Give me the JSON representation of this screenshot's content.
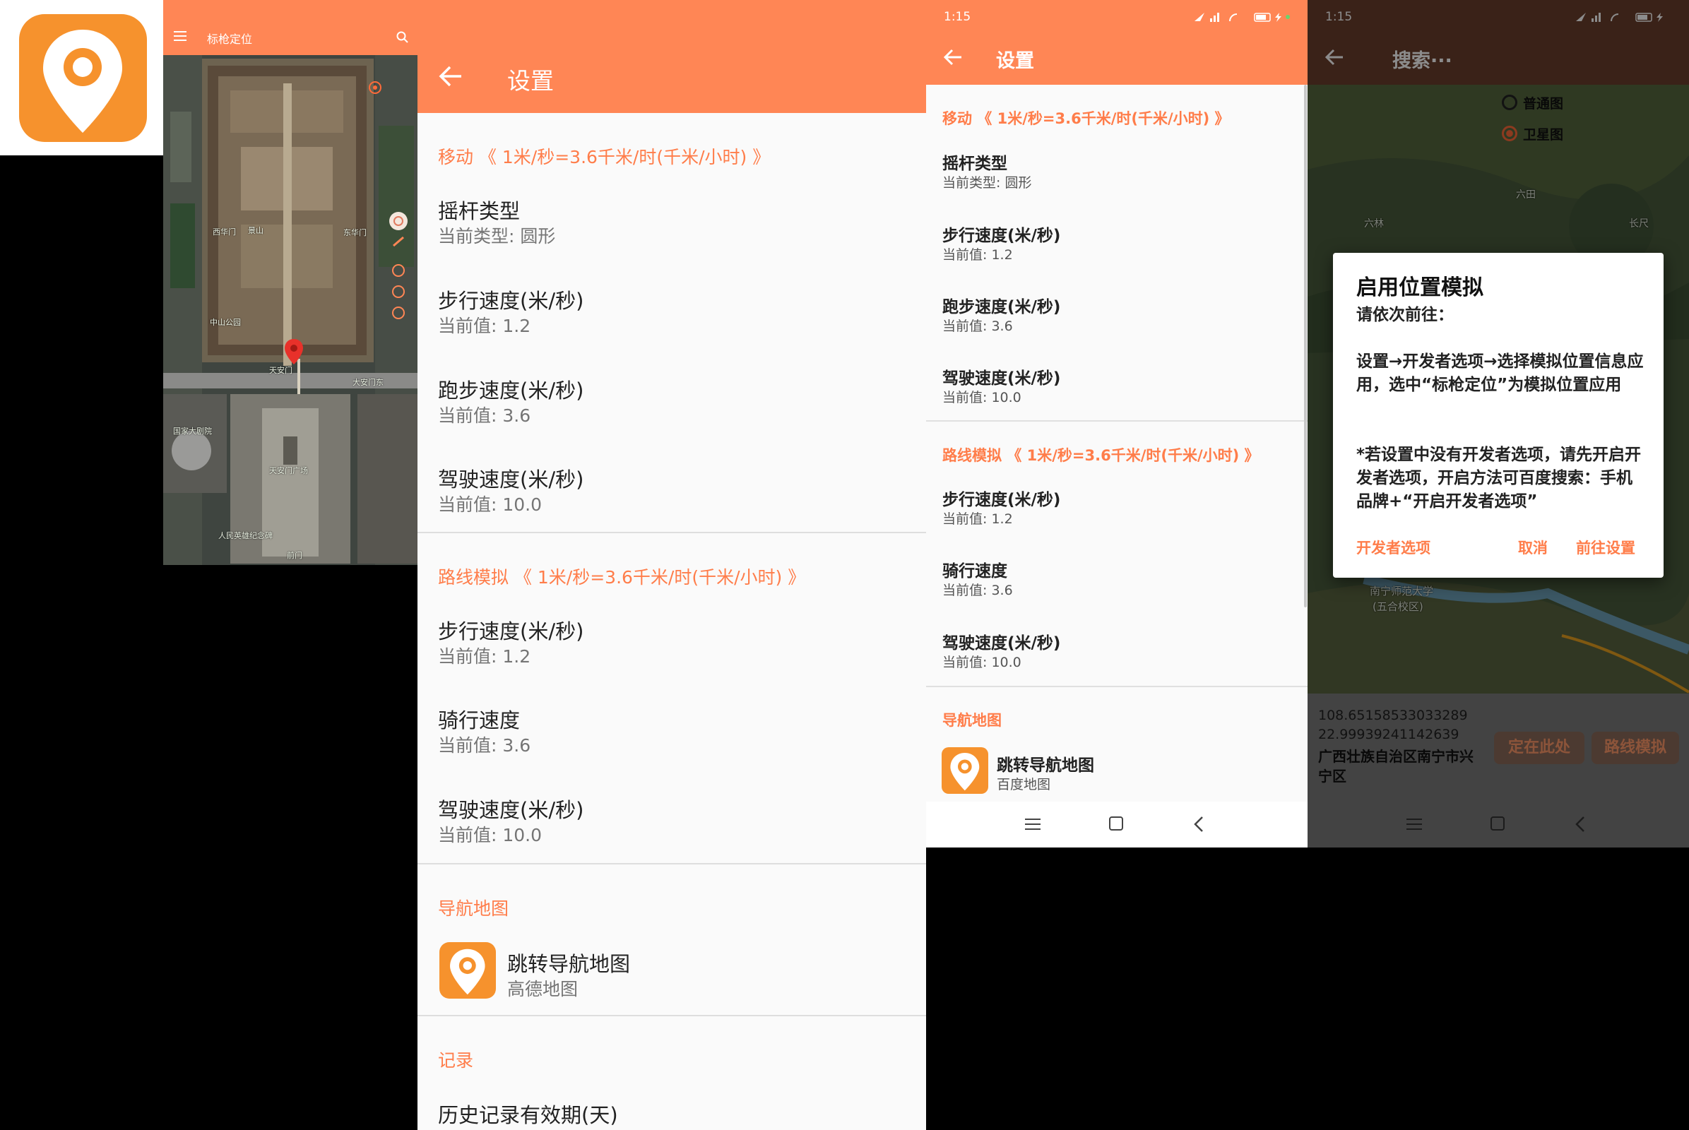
{
  "map_screen": {
    "title": "标枪定位",
    "labels": [
      "西华门",
      "中山公园",
      "天安门",
      "国家大剧院",
      "天安门广场",
      "人民英雄纪念碑",
      "前门",
      "大安门东",
      "景山",
      "东华门"
    ]
  },
  "settings_large": {
    "title": "设置",
    "section_move": "移动 《 1米/秒=3.6千米/时(千米/小时) 》",
    "joystick_title": "摇杆类型",
    "joystick_sub": "当前类型: 圆形",
    "walk_title": "步行速度(米/秒)",
    "walk_sub": "当前值: 1.2",
    "run_title": "跑步速度(米/秒)",
    "run_sub": "当前值: 3.6",
    "drive_title": "驾驶速度(米/秒)",
    "drive_sub": "当前值: 10.0",
    "section_route": "路线模拟 《 1米/秒=3.6千米/时(千米/小时) 》",
    "route_walk_title": "步行速度(米/秒)",
    "route_walk_sub": "当前值: 1.2",
    "route_ride_title": "骑行速度",
    "route_ride_sub": "当前值: 3.6",
    "route_drive_title": "驾驶速度(米/秒)",
    "route_drive_sub": "当前值: 10.0",
    "section_nav": "导航地图",
    "nav_title": "跳转导航地图",
    "nav_sub": "高德地图",
    "section_record": "记录",
    "history_title": "历史记录有效期(天)"
  },
  "settings_small": {
    "time": "1:15",
    "title": "设置",
    "section_move": "移动 《 1米/秒=3.6千米/时(千米/小时) 》",
    "joystick_title": "摇杆类型",
    "joystick_sub": "当前类型: 圆形",
    "walk_title": "步行速度(米/秒)",
    "walk_sub": "当前值: 1.2",
    "run_title": "跑步速度(米/秒)",
    "run_sub": "当前值: 3.6",
    "drive_title": "驾驶速度(米/秒)",
    "drive_sub": "当前值: 10.0",
    "section_route": "路线模拟 《 1米/秒=3.6千米/时(千米/小时) 》",
    "route_walk_title": "步行速度(米/秒)",
    "route_walk_sub": "当前值: 1.2",
    "route_ride_title": "骑行速度",
    "route_ride_sub": "当前值: 3.6",
    "route_drive_title": "驾驶速度(米/秒)",
    "route_drive_sub": "当前值: 10.0",
    "section_nav": "导航地图",
    "nav_title": "跳转导航地图",
    "nav_sub": "百度地图"
  },
  "dialog_screen": {
    "time": "1:15",
    "search_placeholder": "搜索···",
    "map_type_normal": "普通图",
    "map_type_satellite": "卫星图",
    "map_labels": [
      "六田",
      "六林",
      "长尺",
      "南宁师范大学",
      "(五合校区)"
    ],
    "longitude": "108.65158533033289",
    "latitude": "22.99939241142639",
    "address": "广西壮族自治区南宁市兴宁区",
    "btn_locate": "定在此处",
    "btn_route": "路线模拟",
    "dialog": {
      "title": "启用位置模拟",
      "intro": "请依次前往：",
      "step": "设置→开发者选项→选择模拟位置信息应用，选中“标枪定位”为模拟位置应用",
      "note": "*若设置中没有开发者选项，请先开启开发者选项，开启方法可百度搜索：手机品牌+“开启开发者选项”",
      "btn_dev": "开发者选项",
      "btn_cancel": "取消",
      "btn_go": "前往设置"
    }
  },
  "colors": {
    "accent": "#ff8655",
    "accent_text": "#ff7d4a",
    "icon_orange": "#f6922d"
  }
}
